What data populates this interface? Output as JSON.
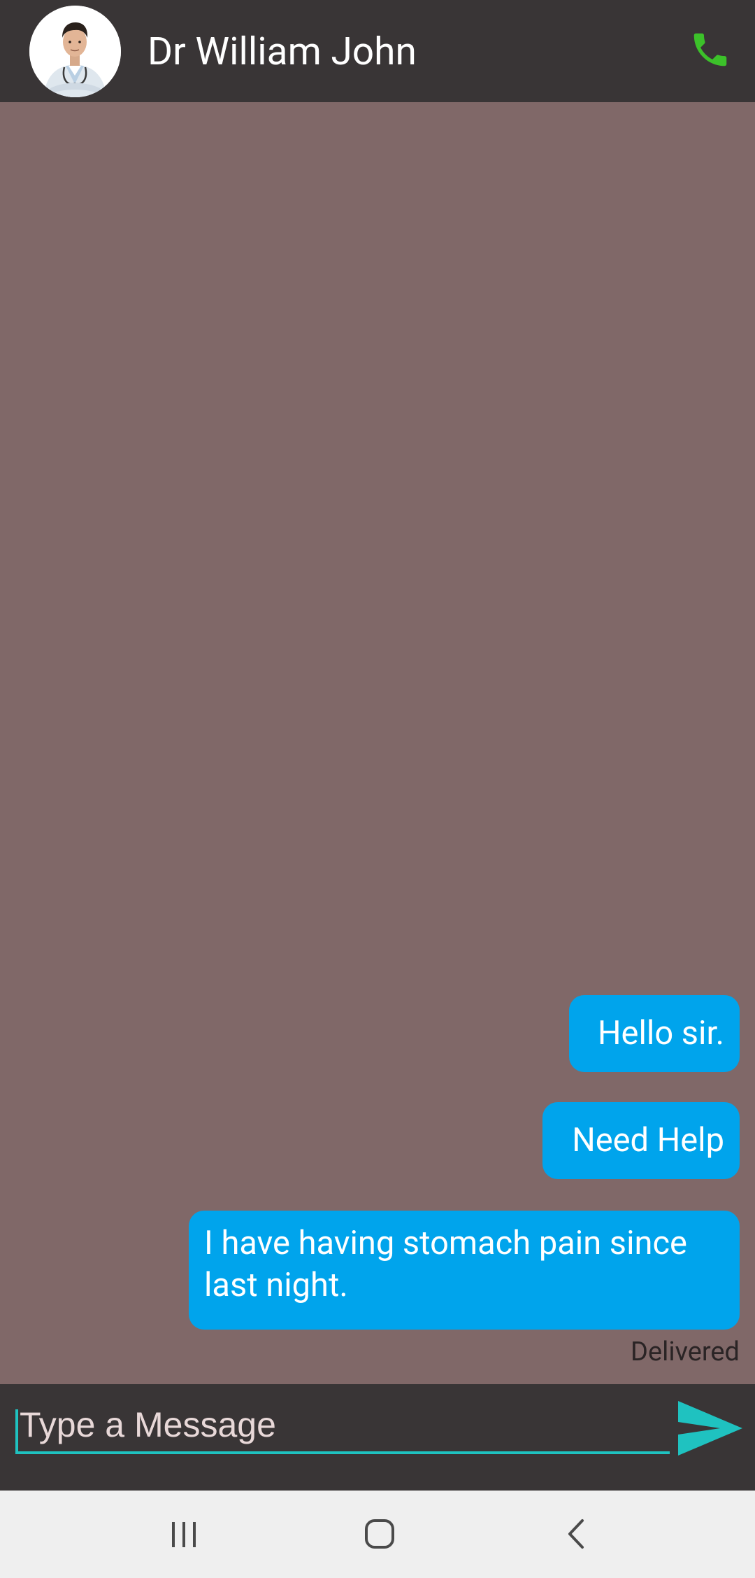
{
  "header": {
    "contact_name": "Dr William John",
    "avatar_icon": "doctor-avatar",
    "call_icon": "phone-icon",
    "call_icon_color": "#3cc12a"
  },
  "messages": [
    {
      "text": "Hello sir.",
      "direction": "outgoing"
    },
    {
      "text": "Need Help",
      "direction": "outgoing"
    },
    {
      "text": "I have having stomach pain since last night.",
      "direction": "outgoing"
    }
  ],
  "delivery_status": "Delivered",
  "composer": {
    "placeholder": "Type a Message",
    "value": "",
    "send_icon": "send-icon",
    "accent_color": "#1fc2c0"
  },
  "navbar": {
    "recent_icon": "recent-apps-icon",
    "home_icon": "home-icon",
    "back_icon": "back-icon"
  },
  "colors": {
    "header_bg": "#393536",
    "chat_bg": "#806868",
    "bubble_bg": "#00a4ec",
    "navbar_bg": "#efefef"
  }
}
